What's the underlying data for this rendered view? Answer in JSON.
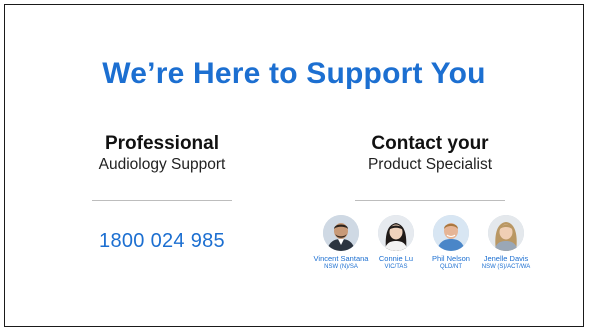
{
  "title": "We’re Here to Support You",
  "left": {
    "heading": "Professional",
    "subheading": "Audiology Support",
    "phone": "1800 024 985"
  },
  "right": {
    "heading": "Contact your",
    "subheading": "Product Specialist",
    "specialists": [
      {
        "name": "Vincent Santana",
        "region": "NSW (N)/SA",
        "icon": "person-avatar-icon"
      },
      {
        "name": "Connie Lu",
        "region": "VIC/TAS",
        "icon": "person-avatar-icon"
      },
      {
        "name": "Phil Nelson",
        "region": "QLD/NT",
        "icon": "person-avatar-icon"
      },
      {
        "name": "Jenelle Davis",
        "region": "NSW (S)/ACT/WA",
        "icon": "person-avatar-icon"
      }
    ]
  },
  "colors": {
    "accent_blue": "#1c6fd1",
    "heading_text": "#111111",
    "border": "#1a1a1a"
  }
}
